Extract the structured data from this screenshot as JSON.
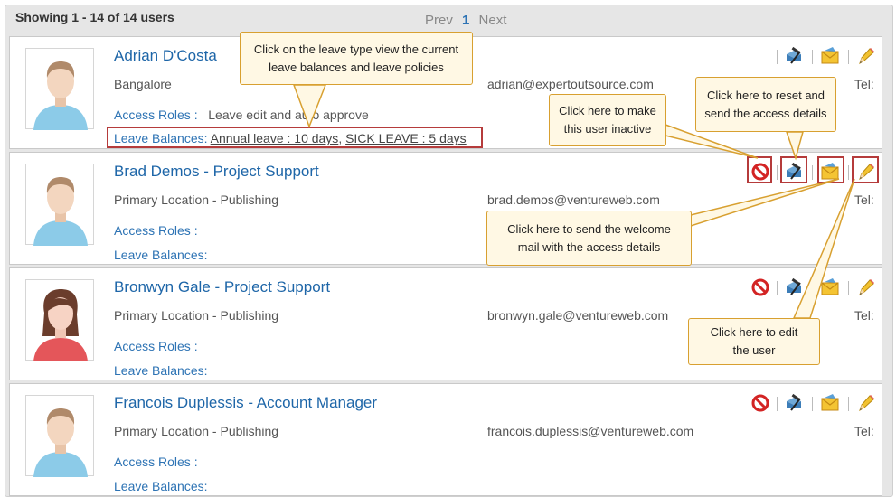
{
  "header": {
    "summary": "Showing 1 - 14 of 14 users",
    "prev": "Prev",
    "current_page": "1",
    "next": "Next"
  },
  "labels": {
    "access_roles": "Access Roles :",
    "leave_balances": "Leave Balances:",
    "tel": "Tel:"
  },
  "users": [
    {
      "name": "Adrian D'Costa",
      "location": "Bangalore",
      "email": "adrian@expertoutsource.com",
      "access_roles": "Leave edit and auto approve",
      "leave": {
        "annual": "Annual leave : 10 days",
        "sick": "SICK LEAVE : 5 days",
        "sep": ","
      },
      "gender": "male",
      "show_inactive_icon": false
    },
    {
      "name": "Brad Demos  - Project Support",
      "location": "Primary Location  - Publishing",
      "email": "brad.demos@ventureweb.com",
      "gender": "male",
      "show_inactive_icon": true
    },
    {
      "name": "Bronwyn Gale  - Project Support",
      "location": "Primary Location  - Publishing",
      "email": "bronwyn.gale@ventureweb.com",
      "gender": "female",
      "show_inactive_icon": true
    },
    {
      "name": "Francois Duplessis  - Account Manager",
      "location": "Primary Location  - Publishing",
      "email": "francois.duplessis@ventureweb.com",
      "gender": "male",
      "show_inactive_icon": true
    }
  ],
  "callouts": {
    "leave_type": "Click on the leave type view  the current leave balances and leave policies",
    "inactive": "Click here to make this user inactive",
    "reset": "Click here to reset and send the access details",
    "welcome": "Click here to send the welcome mail with the access details",
    "edit": "Click here to edit the user"
  },
  "icons": {
    "inactive": "no-entry-icon",
    "reset": "reset-access-icon",
    "mail": "envelope-icon",
    "edit": "pencil-icon"
  },
  "colors": {
    "link": "#1e66a8",
    "highlight": "#b53b3b",
    "callout_border": "#d8a030",
    "callout_fill": "#fff8e4"
  }
}
